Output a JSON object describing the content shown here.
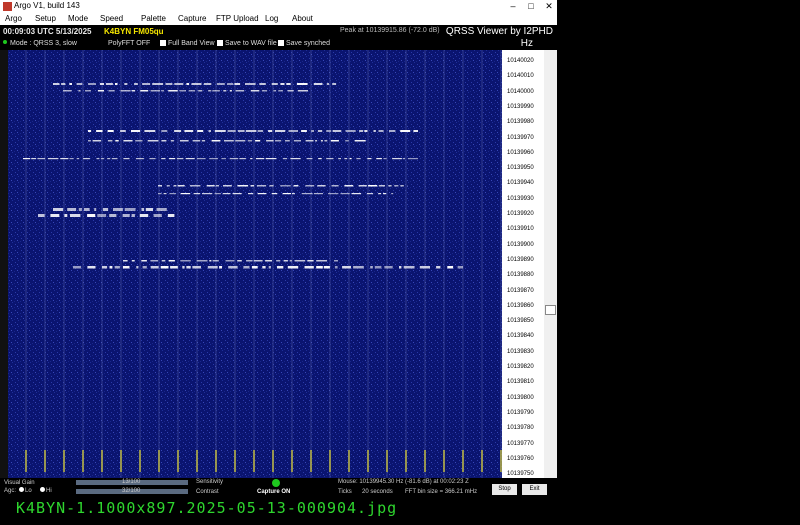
{
  "window": {
    "title": "Argo V1, build 143",
    "controls": [
      "–",
      "□",
      "✕"
    ]
  },
  "menu": [
    "Argo",
    "Setup",
    "Mode",
    "Speed",
    "Palette",
    "Capture",
    "FTP Upload",
    "Log",
    "About"
  ],
  "info": {
    "utc": "00:09:03 UTC 5/13/2025",
    "callsign": "K4BYN FM05qu",
    "peak": "Peak at 10139915.86 (-72.0 dB)",
    "viewer": "QRSS Viewer by I2PHD"
  },
  "options": {
    "mode": "Mode : QRSS 3, slow",
    "polyfft": "PolyFFT OFF",
    "full_band": "Full Band View",
    "save_wav": "Save to WAV file",
    "save_synced": "Save synched",
    "hz": "Hz"
  },
  "scale_labels": [
    "10140020",
    "10140010",
    "10140000",
    "10139990",
    "10139980",
    "10139970",
    "10139960",
    "10139950",
    "10139940",
    "10139930",
    "10139920",
    "10139910",
    "10139900",
    "10139890",
    "10139880",
    "10139870",
    "10139860",
    "10139850",
    "10139840",
    "10139830",
    "10139820",
    "10139810",
    "10139800",
    "10139790",
    "10139780",
    "10139770",
    "10139760",
    "10139750"
  ],
  "bottom": {
    "visual_gain": "Visual Gain",
    "agc": "Agc:",
    "lo": "Lo",
    "hi": "Hi",
    "value_1": "13/100",
    "value_2": "32/100",
    "sensitivity": "Sensitivity",
    "contrast": "Contrast",
    "capture": "Capture ON",
    "mouse": "Mouse:  10139945.30 Hz  (-81.6 dB) at 00:02:23 Z",
    "ticks_label": "Ticks",
    "ticks_value": "20 seconds",
    "fft": "FFT bin size = 366.21 mHz",
    "stop": "Stop",
    "exit": "Exit"
  },
  "filename": "K4BYN-1.1000x897.2025-05-13-000904.jpg",
  "colors": {
    "waterfall_bg": "#0a1470",
    "signal": "#ffffff",
    "callsign": "#f5e600",
    "filename": "#2ed62e",
    "capture_led": "#1ec81e"
  }
}
